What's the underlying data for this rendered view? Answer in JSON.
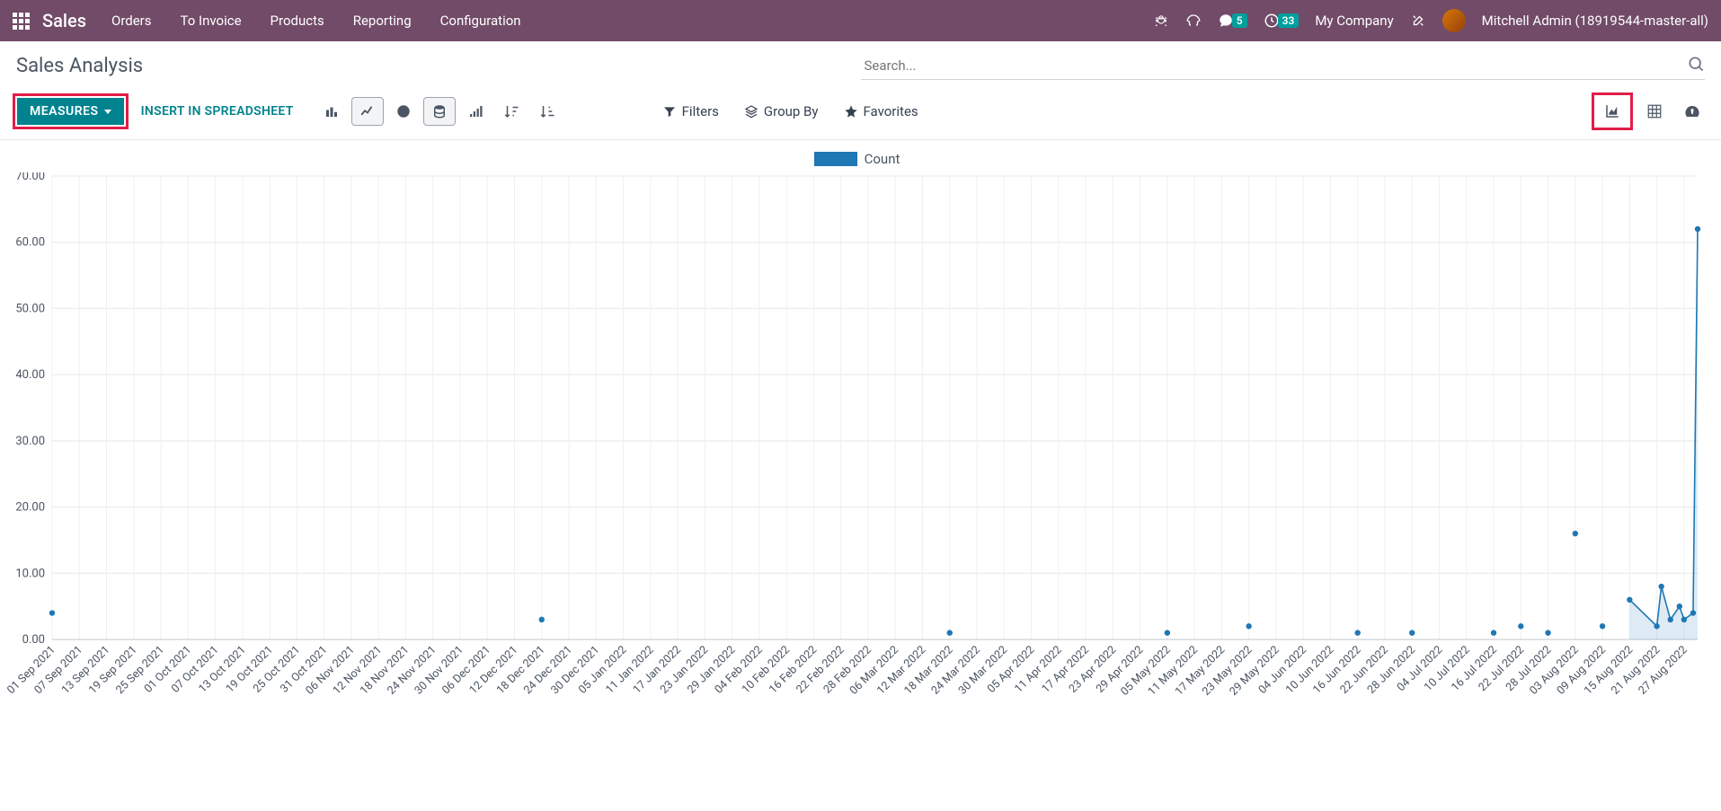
{
  "header": {
    "app_name": "Sales",
    "menu": [
      "Orders",
      "To Invoice",
      "Products",
      "Reporting",
      "Configuration"
    ],
    "msg_badge": "5",
    "activity_badge": "33",
    "company": "My Company",
    "user": "Mitchell Admin (18919544-master-all)"
  },
  "page": {
    "title": "Sales Analysis",
    "search_placeholder": "Search..."
  },
  "controls": {
    "measures_label": "MEASURES",
    "insert_label": "INSERT IN SPREADSHEET",
    "filters_label": "Filters",
    "groupby_label": "Group By",
    "favorites_label": "Favorites"
  },
  "legend": {
    "series": "Count"
  },
  "chart_data": {
    "type": "line",
    "title": "",
    "xlabel": "",
    "ylabel": "",
    "ylim": [
      0,
      70
    ],
    "yticks": [
      0,
      10,
      20,
      30,
      40,
      50,
      60,
      70
    ],
    "categories": [
      "01 Sep 2021",
      "07 Sep 2021",
      "13 Sep 2021",
      "19 Sep 2021",
      "25 Sep 2021",
      "01 Oct 2021",
      "07 Oct 2021",
      "13 Oct 2021",
      "19 Oct 2021",
      "25 Oct 2021",
      "31 Oct 2021",
      "06 Nov 2021",
      "12 Nov 2021",
      "18 Nov 2021",
      "24 Nov 2021",
      "30 Nov 2021",
      "06 Dec 2021",
      "12 Dec 2021",
      "18 Dec 2021",
      "24 Dec 2021",
      "30 Dec 2021",
      "05 Jan 2022",
      "11 Jan 2022",
      "17 Jan 2022",
      "23 Jan 2022",
      "29 Jan 2022",
      "04 Feb 2022",
      "10 Feb 2022",
      "16 Feb 2022",
      "22 Feb 2022",
      "28 Feb 2022",
      "06 Mar 2022",
      "12 Mar 2022",
      "18 Mar 2022",
      "24 Mar 2022",
      "30 Mar 2022",
      "05 Apr 2022",
      "11 Apr 2022",
      "17 Apr 2022",
      "23 Apr 2022",
      "29 Apr 2022",
      "05 May 2022",
      "11 May 2022",
      "17 May 2022",
      "23 May 2022",
      "29 May 2022",
      "04 Jun 2022",
      "10 Jun 2022",
      "16 Jun 2022",
      "22 Jun 2022",
      "28 Jun 2022",
      "04 Jul 2022",
      "10 Jul 2022",
      "16 Jul 2022",
      "22 Jul 2022",
      "28 Jul 2022",
      "03 Aug 2022",
      "09 Aug 2022",
      "15 Aug 2022",
      "21 Aug 2022",
      "27 Aug 2022"
    ],
    "series": [
      {
        "name": "Count",
        "points": [
          {
            "x": "01 Sep 2021",
            "y": 4
          },
          {
            "x": "18 Dec 2021",
            "y": 3
          },
          {
            "x": "18 Mar 2022",
            "y": 1
          },
          {
            "x": "05 May 2022",
            "y": 1
          },
          {
            "x": "23 May 2022",
            "y": 2
          },
          {
            "x": "16 Jun 2022",
            "y": 1
          },
          {
            "x": "28 Jun 2022",
            "y": 1
          },
          {
            "x": "16 Jul 2022",
            "y": 1
          },
          {
            "x": "22 Jul 2022",
            "y": 2
          },
          {
            "x": "28 Jul 2022",
            "y": 1
          },
          {
            "x": "03 Aug 2022",
            "y": 16
          },
          {
            "x": "09 Aug 2022",
            "y": 2
          },
          {
            "x": "15 Aug 2022",
            "y": 6
          },
          {
            "x": "21 Aug 2022",
            "y": 2
          },
          {
            "x": "22 Aug 2022",
            "y": 8
          },
          {
            "x": "24 Aug 2022",
            "y": 3
          },
          {
            "x": "26 Aug 2022",
            "y": 5
          },
          {
            "x": "27 Aug 2022",
            "y": 3
          },
          {
            "x": "29 Aug 2022",
            "y": 4
          },
          {
            "x": "30 Aug 2022",
            "y": 62
          }
        ]
      }
    ]
  }
}
